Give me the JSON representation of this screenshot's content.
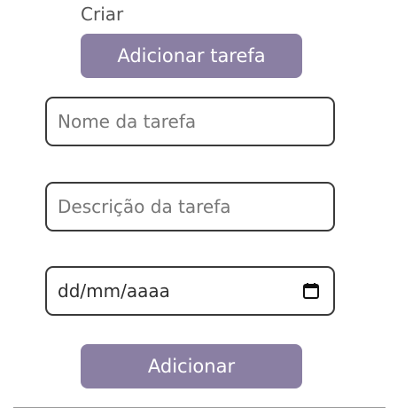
{
  "section": {
    "heading": "Criar"
  },
  "toggle_button": {
    "label": "Adicionar tarefa"
  },
  "form": {
    "name": {
      "placeholder": "Nome da tarefa",
      "value": ""
    },
    "description": {
      "placeholder": "Descrição da tarefa",
      "value": ""
    },
    "date": {
      "placeholder": "dd/mm/aaaa",
      "icon": "calendar-icon"
    },
    "submit_label": "Adicionar"
  },
  "colors": {
    "button_bg": "#8a7fa3",
    "button_text": "#ffffff",
    "field_border": "#3a3a3a"
  }
}
